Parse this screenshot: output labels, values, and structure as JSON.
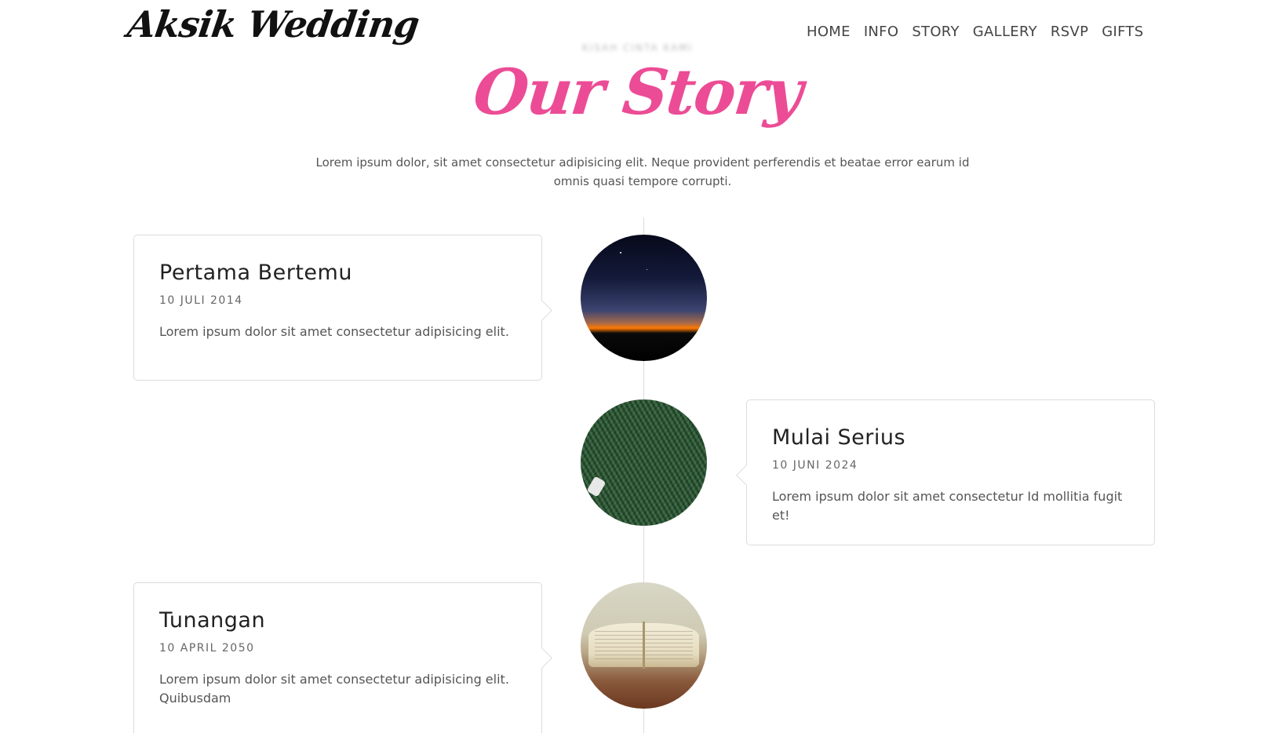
{
  "header": {
    "logo": "Aksik Wedding",
    "nav": [
      "HOME",
      "INFO",
      "STORY",
      "GALLERY",
      "RSVP",
      "GIFTS"
    ]
  },
  "section": {
    "eyebrow": "KISAH CINTA KAMI",
    "title": "Our Story",
    "description": "Lorem ipsum dolor, sit amet consectetur adipisicing elit. Neque provident perferendis et beatae error earum id omnis quasi tempore corrupti."
  },
  "timeline": [
    {
      "title": "Pertama Bertemu",
      "date": "10 JULI 2014",
      "text": "Lorem ipsum dolor sit amet consectetur adipisicing elit.",
      "image": "night-sky-sunset-photo"
    },
    {
      "title": "Mulai Serius",
      "date": "10 JUNI 2024",
      "text": "Lorem ipsum dolor sit amet consectetur Id mollitia fugit et!",
      "image": "grass-field-photo"
    },
    {
      "title": "Tunangan",
      "date": "10 APRIL 2050",
      "text": "Lorem ipsum dolor sit amet consectetur adipisicing elit. Quibusdam",
      "image": "open-book-photo"
    }
  ],
  "colors": {
    "accent": "#ec4c96",
    "text": "#222222",
    "muted": "#555555",
    "border": "#dcdcdc"
  }
}
